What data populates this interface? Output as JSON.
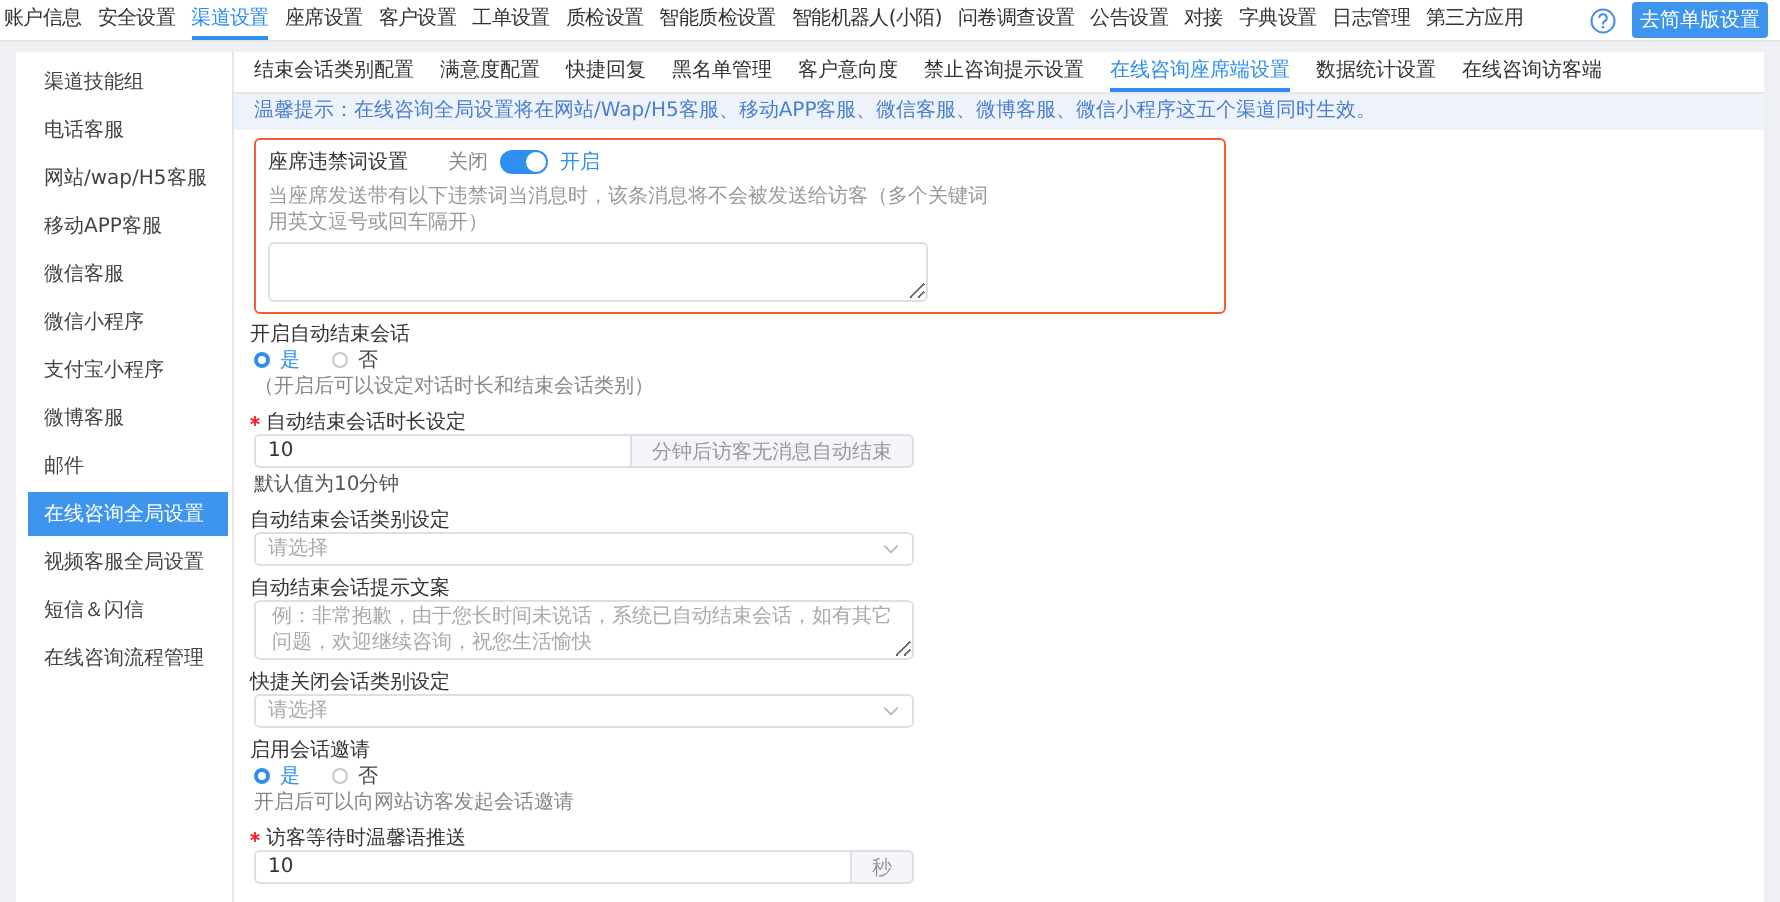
{
  "top_nav": {
    "items": [
      {
        "label": "账户信息",
        "selected": false
      },
      {
        "label": "安全设置",
        "selected": false
      },
      {
        "label": "渠道设置",
        "selected": true
      },
      {
        "label": "座席设置",
        "selected": false
      },
      {
        "label": "客户设置",
        "selected": false
      },
      {
        "label": "工单设置",
        "selected": false
      },
      {
        "label": "质检设置",
        "selected": false
      },
      {
        "label": "智能质检设置",
        "selected": false
      },
      {
        "label": "智能机器人(小陌)",
        "selected": false
      },
      {
        "label": "问卷调查设置",
        "selected": false
      },
      {
        "label": "公告设置",
        "selected": false
      },
      {
        "label": "对接",
        "selected": false
      },
      {
        "label": "字典设置",
        "selected": false
      },
      {
        "label": "日志管理",
        "selected": false
      },
      {
        "label": "第三方应用",
        "selected": false
      }
    ],
    "button": "去简单版设置"
  },
  "sidebar": {
    "items": [
      {
        "label": "渠道技能组",
        "selected": false
      },
      {
        "label": "电话客服",
        "selected": false
      },
      {
        "label": "网站/wap/H5客服",
        "selected": false
      },
      {
        "label": "移动APP客服",
        "selected": false
      },
      {
        "label": "微信客服",
        "selected": false
      },
      {
        "label": "微信小程序",
        "selected": false
      },
      {
        "label": "支付宝小程序",
        "selected": false
      },
      {
        "label": "微博客服",
        "selected": false
      },
      {
        "label": "邮件",
        "selected": false
      },
      {
        "label": "在线咨询全局设置",
        "selected": true
      },
      {
        "label": "视频客服全局设置",
        "selected": false
      },
      {
        "label": "短信＆闪信",
        "selected": false
      },
      {
        "label": "在线咨询流程管理",
        "selected": false
      }
    ]
  },
  "sub_tabs": [
    {
      "label": "结束会话类别配置",
      "selected": false
    },
    {
      "label": "满意度配置",
      "selected": false
    },
    {
      "label": "快捷回复",
      "selected": false
    },
    {
      "label": "黑名单管理",
      "selected": false
    },
    {
      "label": "客户意向度",
      "selected": false
    },
    {
      "label": "禁止咨询提示设置",
      "selected": false
    },
    {
      "label": "在线咨询座席端设置",
      "selected": true
    },
    {
      "label": "数据统计设置",
      "selected": false
    },
    {
      "label": "在线咨询访客端",
      "selected": false
    }
  ],
  "tip": "温馨提示：在线咨询全局设置将在网站/Wap/H5客服、移动APP客服、微信客服、微博客服、微信小程序这五个渠道同时生效。",
  "forbidden_words": {
    "title": "座席违禁词设置",
    "off_label": "关闭",
    "on_label": "开启",
    "on": true,
    "description": "当座席发送带有以下违禁词当消息时，该条消息将不会被发送给访客（多个关键词用英文逗号或回车隔开）"
  },
  "fields": [
    {
      "kind": "radio",
      "label": "开启自动结束会话",
      "options": [
        {
          "label": "是",
          "selected": true
        },
        {
          "label": "否",
          "selected": false
        }
      ],
      "hint": "（开启后可以设定对话时长和结束会话类别）"
    },
    {
      "kind": "input",
      "required": true,
      "label": "自动结束会话时长设定",
      "value": "10",
      "suffix": "分钟后访客无消息自动结束",
      "hint": "默认值为10分钟"
    },
    {
      "kind": "select",
      "label": "自动结束会话类别设定",
      "placeholder": "请选择"
    },
    {
      "kind": "textarea",
      "label": "自动结束会话提示文案",
      "placeholder": "例：非常抱歉，由于您长时间未说话，系统已自动结束会话，如有其它问题，欢迎继续咨询，祝您生活愉快"
    },
    {
      "kind": "select",
      "label": "快捷关闭会话类别设定",
      "placeholder": "请选择"
    },
    {
      "kind": "radio",
      "label": "启用会话邀请",
      "options": [
        {
          "label": "是",
          "selected": true
        },
        {
          "label": "否",
          "selected": false
        }
      ],
      "hint": "开启后可以向网站访客发起会话邀请"
    },
    {
      "kind": "input",
      "required": true,
      "label": "访客等待时温馨语推送",
      "value": "10",
      "suffix": "秒"
    }
  ]
}
